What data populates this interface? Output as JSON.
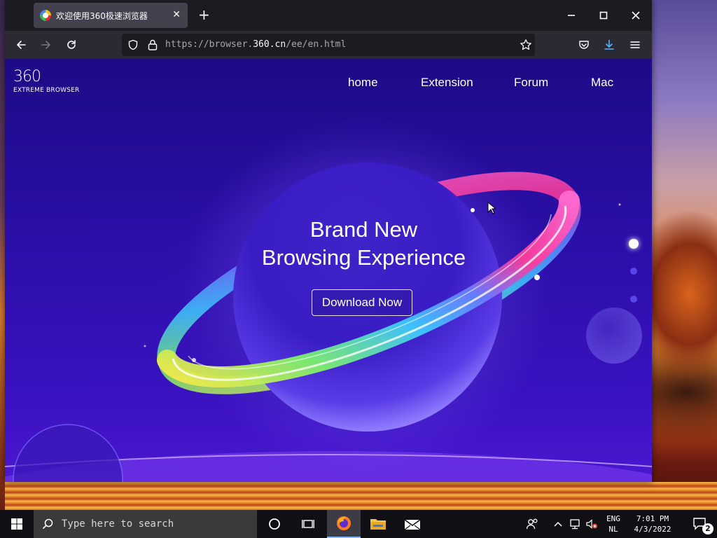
{
  "browser": {
    "tab_title": "欢迎使用360极速浏览器",
    "tab_close": "✕",
    "new_tab": "+",
    "url_prefix": "https://browser.",
    "url_host": "360.cn",
    "url_path": "/ee/en.html"
  },
  "site": {
    "brand_number": "360",
    "brand_tagline": "EXTREME BROWSER",
    "nav": [
      "home",
      "Extension",
      "Forum",
      "Mac"
    ],
    "headline_line1": "Brand New",
    "headline_line2": "Browsing Experience",
    "cta": "Download Now",
    "carousel": {
      "pages": 3,
      "active_index": 0
    }
  },
  "taskbar": {
    "search_placeholder": "Type here to search",
    "lang_line1": "ENG",
    "lang_line2": "NL",
    "time": "7:01 PM",
    "date": "4/3/2022",
    "notification_count": "2"
  },
  "colors": {
    "page_bg": "#2a0ea6",
    "accent_download": "#4fb3ff",
    "taskbar_bg": "#101014"
  }
}
